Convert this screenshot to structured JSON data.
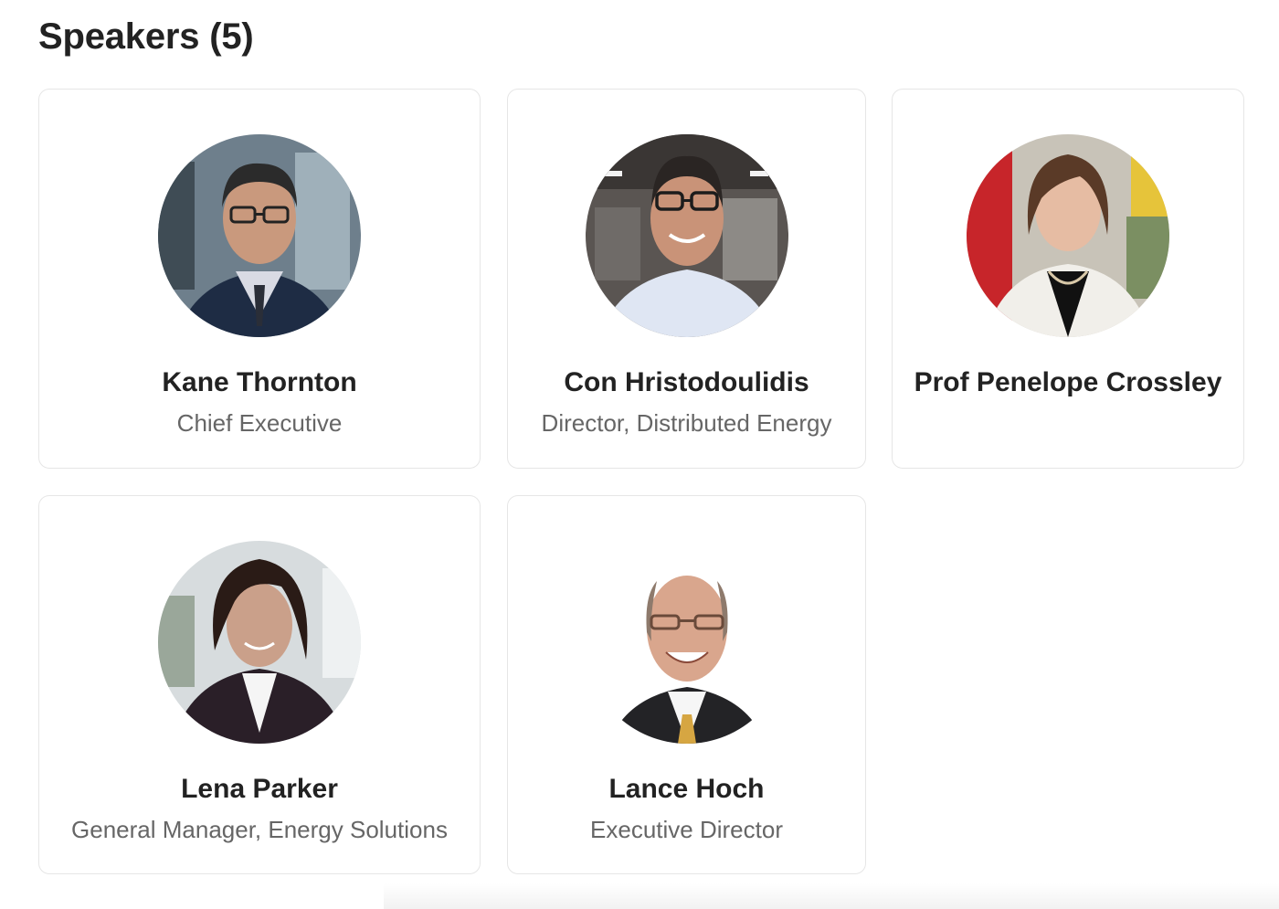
{
  "page": {
    "title": "Speakers (5)"
  },
  "speakers": [
    {
      "name": "Kane Thornton",
      "role": "Chief Executive",
      "avatar_icon": "person-photo-icon"
    },
    {
      "name": "Con Hristodoulidis",
      "role": "Director, Distributed Energy",
      "avatar_icon": "person-photo-icon"
    },
    {
      "name": "Prof Penelope Crossley",
      "role": "",
      "avatar_icon": "person-photo-icon"
    },
    {
      "name": "Lena Parker",
      "role": "General Manager, Energy Solutions",
      "avatar_icon": "person-photo-icon"
    },
    {
      "name": "Lance Hoch",
      "role": "Executive Director",
      "avatar_icon": "person-photo-icon"
    }
  ],
  "colors": {
    "card_border": "#e6e6e6",
    "name_text": "#222222",
    "role_text": "#666666"
  }
}
